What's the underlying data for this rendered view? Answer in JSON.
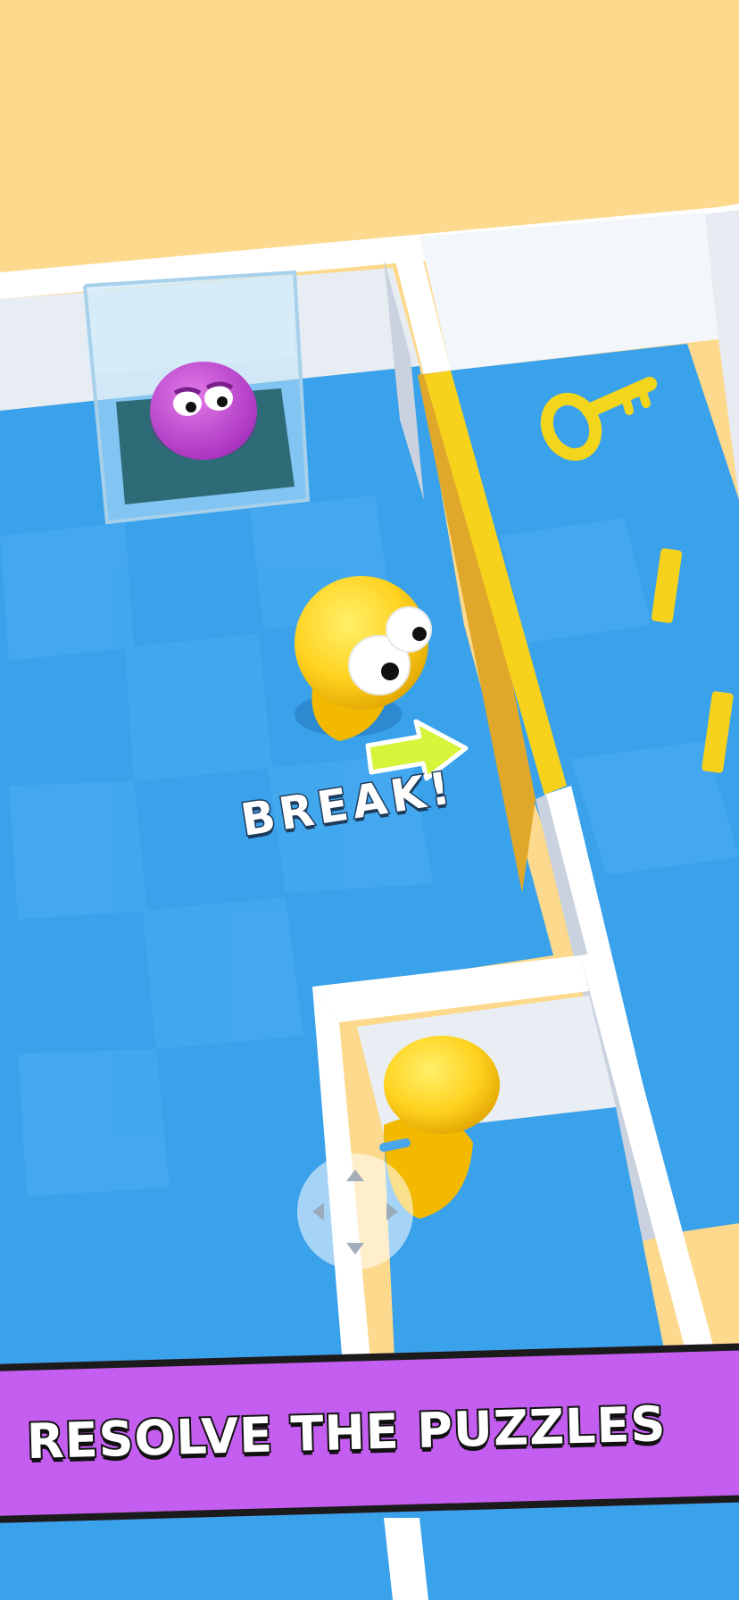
{
  "game": {
    "hint_label": "BREAK!",
    "banner_text": "RESOLVE THE PUZZLES"
  },
  "colors": {
    "background": "#fcd98c",
    "floor": "#3aa1eb",
    "wall": "#ffffff",
    "breakable_wall": "#f7c21c",
    "player": "#ffd21f",
    "trapped_friend": "#c24ad1",
    "key": "#f8e31a",
    "banner": "#c45ef0"
  },
  "icons": [
    "arrow-right-icon",
    "key-icon",
    "dpad-icon"
  ]
}
